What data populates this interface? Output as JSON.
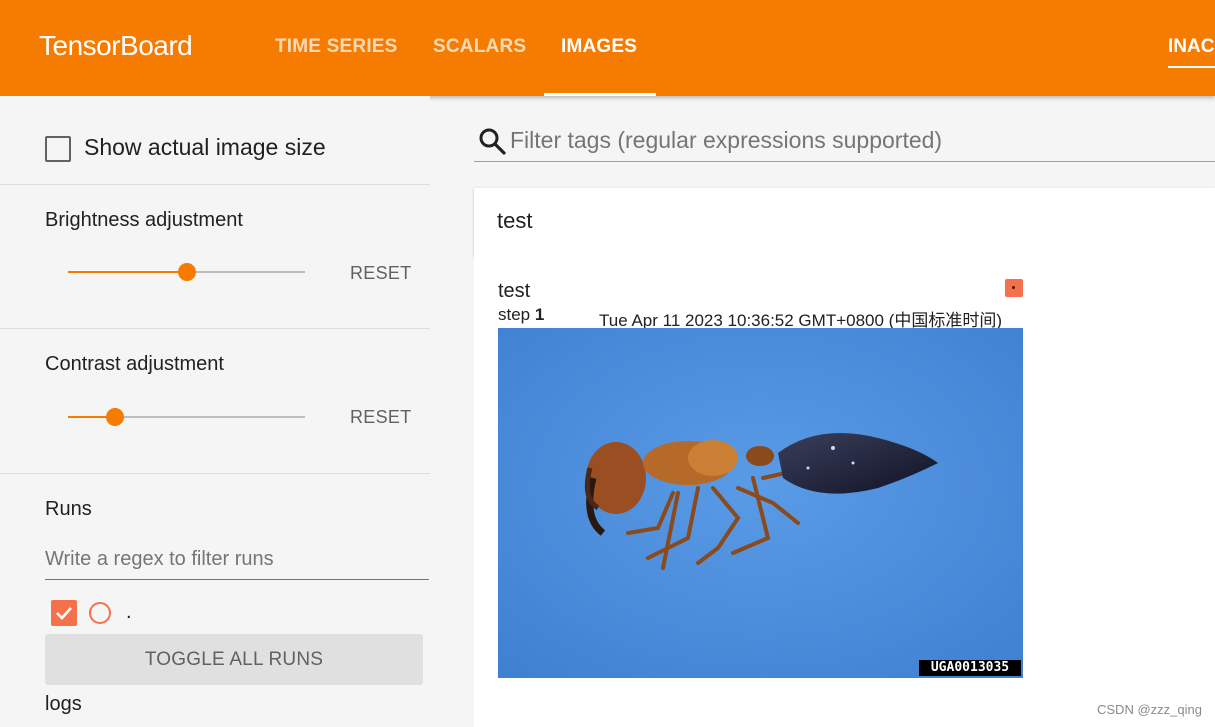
{
  "header": {
    "brand": "TensorBoard",
    "tabs": [
      {
        "label": "TIME SERIES",
        "active": false
      },
      {
        "label": "SCALARS",
        "active": false
      },
      {
        "label": "IMAGES",
        "active": true
      }
    ],
    "inactive_menu_label": "INAC",
    "colors": {
      "accent": "#f57c00",
      "tab_text": "#ffffff"
    }
  },
  "sidebar": {
    "show_actual_size": {
      "label": "Show actual image size",
      "checked": false
    },
    "brightness": {
      "title": "Brightness adjustment",
      "value": 0.5,
      "reset_label": "RESET"
    },
    "contrast": {
      "title": "Contrast adjustment",
      "value": 0.2,
      "reset_label": "RESET"
    },
    "runs": {
      "title": "Runs",
      "filter_placeholder": "Write a regex to filter runs",
      "items": [
        {
          "name": ".",
          "checked": true
        }
      ],
      "toggle_label": "TOGGLE ALL RUNS",
      "group_label": "logs"
    }
  },
  "main": {
    "tag_filter_placeholder": "Filter tags (regular expressions supported)",
    "group": {
      "title": "test"
    },
    "card": {
      "tag": "test",
      "step_label": "step",
      "step_value": "1",
      "timestamp": "Tue Apr 11 2023 10:36:52 GMT+0800 (中国标准时间)",
      "image_label": "UGA0013035",
      "image_subject": "ant on blue background"
    }
  },
  "watermark": "CSDN @zzz_qing"
}
